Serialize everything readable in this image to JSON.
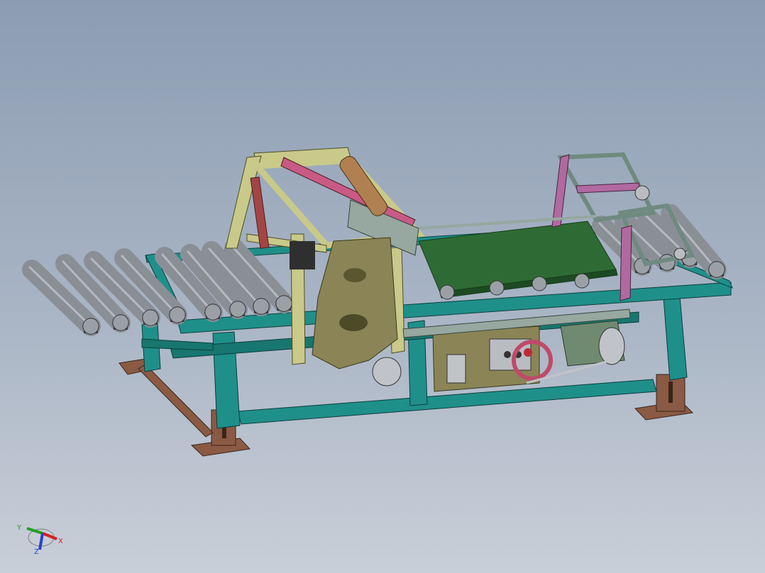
{
  "viewport": {
    "background_top": "#8c9db2",
    "background_bottom": "#c9cfd8"
  },
  "model": {
    "frame_color": "#1f8f8a",
    "frame_dark": "#14625f",
    "roller_color": "#8a8f96",
    "belt_color": "#2e6b34",
    "gantry_color": "#c9c98a",
    "foot_color": "#8a5a45",
    "housing_color": "#8a8456",
    "arm_color": "#b06aa0",
    "motor_color": "#6f8a70"
  },
  "triad": {
    "x_label": "X",
    "y_label": "Y",
    "z_label": "Z",
    "x_color": "#d22222",
    "y_color": "#22a022",
    "z_color": "#2244cc"
  }
}
